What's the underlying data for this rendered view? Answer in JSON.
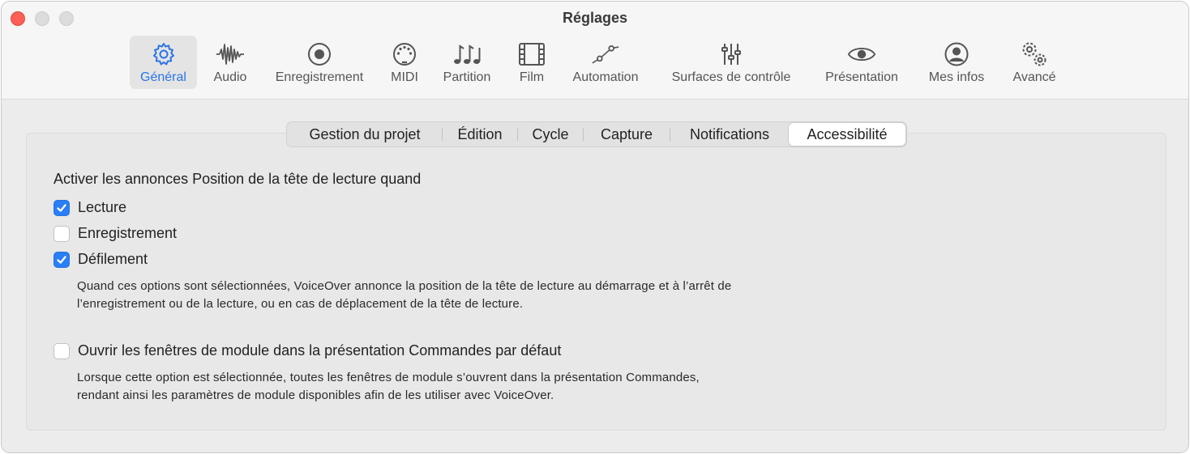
{
  "window": {
    "title": "Réglages"
  },
  "toolbar": {
    "items": [
      {
        "label": "Général",
        "icon": "gear-icon",
        "active": true
      },
      {
        "label": "Audio",
        "icon": "waveform-icon"
      },
      {
        "label": "Enregistrement",
        "icon": "record-icon"
      },
      {
        "label": "MIDI",
        "icon": "midi-connector-icon"
      },
      {
        "label": "Partition",
        "icon": "music-notes-icon"
      },
      {
        "label": "Film",
        "icon": "film-strip-icon"
      },
      {
        "label": "Automation",
        "icon": "automation-curve-icon"
      },
      {
        "label": "Surfaces de contrôle",
        "icon": "faders-icon"
      },
      {
        "label": "Présentation",
        "icon": "eye-icon"
      },
      {
        "label": "Mes infos",
        "icon": "user-icon"
      },
      {
        "label": "Avancé",
        "icon": "gears-icon"
      }
    ]
  },
  "tabs": {
    "items": [
      "Gestion du projet",
      "Édition",
      "Cycle",
      "Capture",
      "Notifications",
      "Accessibilité"
    ],
    "selected": "Accessibilité"
  },
  "content": {
    "heading": "Activer les annonces Position de la tête de lecture quand",
    "options": [
      {
        "label": "Lecture",
        "checked": true
      },
      {
        "label": "Enregistrement",
        "checked": false
      },
      {
        "label": "Défilement",
        "checked": true
      }
    ],
    "options_desc_line1": "Quand ces options sont sélectionnées, VoiceOver annonce la position de la tête de lecture au démarrage et à l’arrêt de",
    "options_desc_line2": "l’enregistrement ou de la lecture, ou en cas de déplacement de la tête de lecture.",
    "plugin_option": {
      "label": "Ouvrir les fenêtres de module dans la présentation Commandes par défaut",
      "checked": false
    },
    "plugin_desc_line1": "Lorsque cette option est sélectionnée, toutes les fenêtres de module s’ouvrent dans la présentation Commandes,",
    "plugin_desc_line2": "rendant ainsi les paramètres de module disponibles afin de les utiliser avec VoiceOver."
  },
  "colors": {
    "accent": "#2a7ef6",
    "close": "#fe5f57"
  }
}
